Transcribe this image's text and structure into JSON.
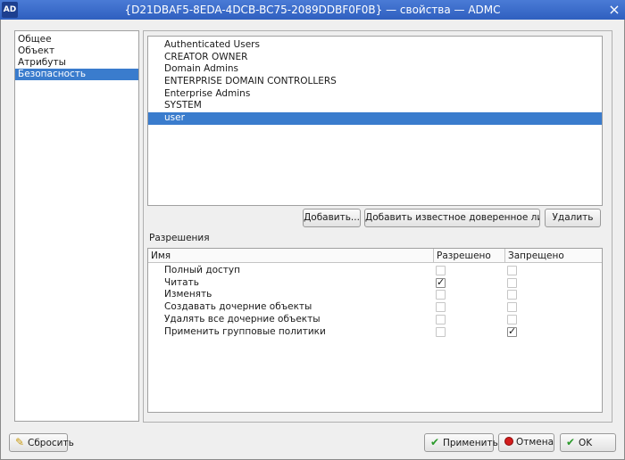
{
  "window": {
    "app_icon": "AD",
    "title": "{D21DBAF5-8EDA-4DCB-BC75-2089DDBF0F0B} — свойства — ADMC",
    "close_glyph": "×"
  },
  "nav": {
    "items": [
      "Общее",
      "Объект",
      "Атрибуты",
      "Безопасность"
    ],
    "selected": "Безопасность"
  },
  "trustees": {
    "items": [
      "Authenticated Users",
      "CREATOR OWNER",
      "Domain Admins",
      "ENTERPRISE DOMAIN CONTROLLERS",
      "Enterprise Admins",
      "SYSTEM",
      "user"
    ],
    "selected": "user"
  },
  "trustee_buttons": {
    "add": "Добавить...",
    "add_well_known": "Добавить известное доверенное лицо...",
    "remove": "Удалить"
  },
  "permissions": {
    "label": "Разрешения",
    "columns": [
      "Имя",
      "Разрешено",
      "Запрещено"
    ],
    "rows": [
      {
        "name": "Полный доступ",
        "allowed": false,
        "denied": false
      },
      {
        "name": "Читать",
        "allowed": true,
        "denied": false
      },
      {
        "name": "Изменять",
        "allowed": false,
        "denied": false
      },
      {
        "name": "Создавать дочерние объекты",
        "allowed": false,
        "denied": false
      },
      {
        "name": "Удалять все дочерние объекты",
        "allowed": false,
        "denied": false
      },
      {
        "name": "Применить групповые политики",
        "allowed": false,
        "denied": true
      }
    ]
  },
  "footer": {
    "reset": "Сбросить",
    "apply": "Применить",
    "cancel": "Отмена",
    "ok": "OK"
  },
  "icons": {
    "reset": "broom-icon",
    "apply": "checkmark-icon",
    "cancel": "stop-icon",
    "ok": "checkmark-icon"
  }
}
